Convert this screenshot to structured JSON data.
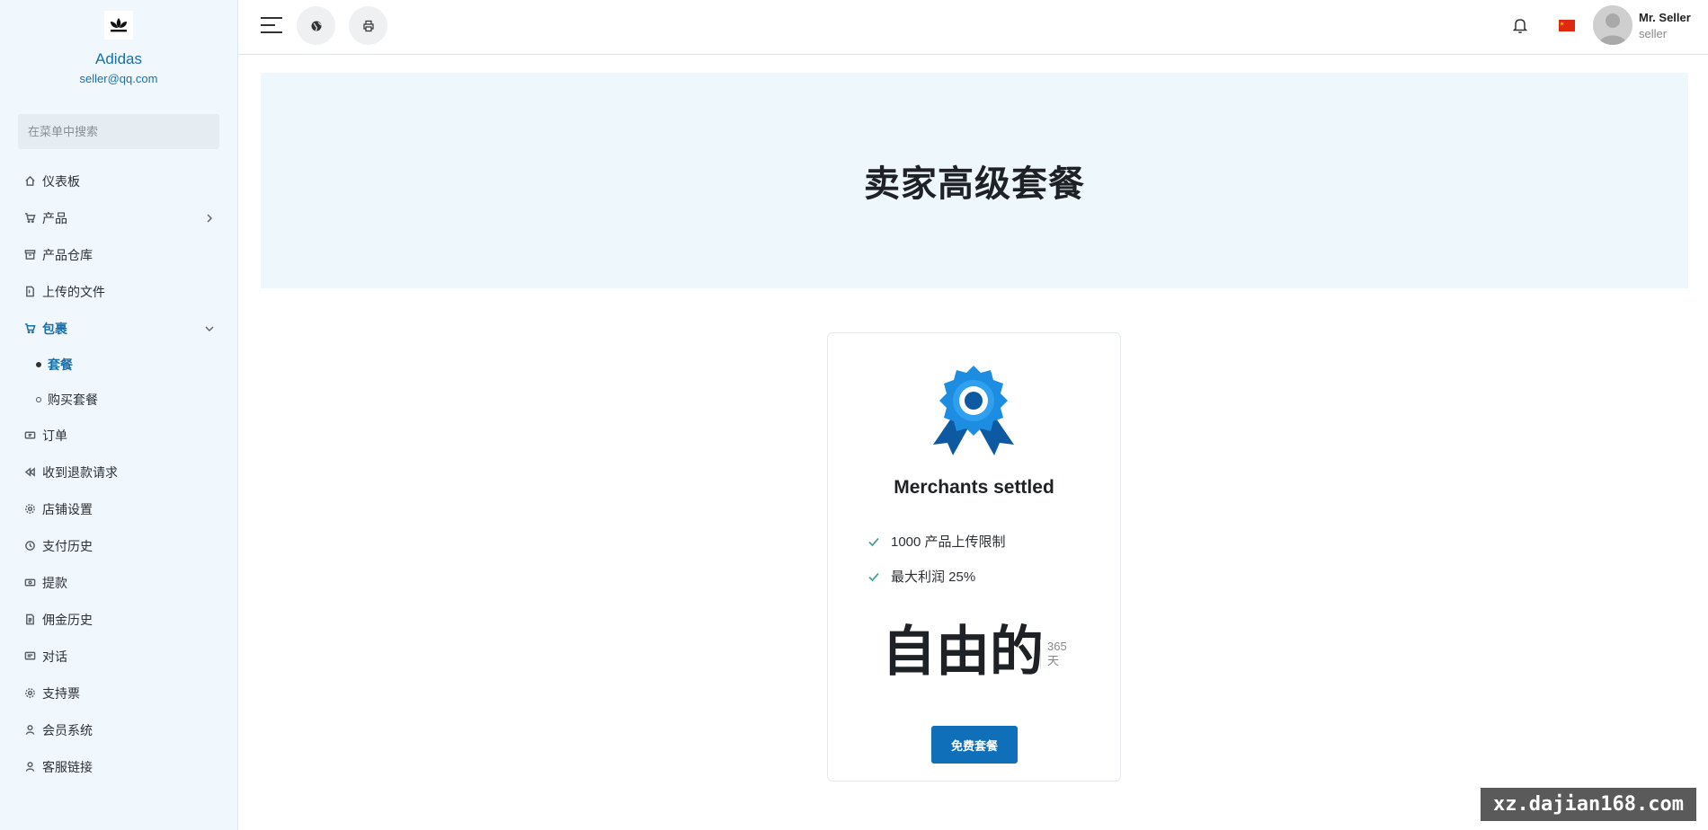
{
  "sidebar": {
    "brand_name": "Adidas",
    "brand_email": "seller@qq.com",
    "search_placeholder": "在菜单中搜索",
    "items": [
      {
        "label": "仪表板",
        "icon": "home-icon"
      },
      {
        "label": "产品",
        "icon": "cart-icon",
        "has_children": true
      },
      {
        "label": "产品仓库",
        "icon": "archive-icon"
      },
      {
        "label": "上传的文件",
        "icon": "file-icon"
      },
      {
        "label": "包裹",
        "icon": "cart-icon",
        "expanded": true,
        "active": true,
        "children": [
          {
            "label": "套餐",
            "active": true
          },
          {
            "label": "购买套餐"
          }
        ]
      },
      {
        "label": "订单",
        "icon": "ticket-icon"
      },
      {
        "label": "收到退款请求",
        "icon": "rewind-icon"
      },
      {
        "label": "店铺设置",
        "icon": "gear-icon"
      },
      {
        "label": "支付历史",
        "icon": "history-icon"
      },
      {
        "label": "提款",
        "icon": "cash-icon"
      },
      {
        "label": "佣金历史",
        "icon": "document-icon"
      },
      {
        "label": "对话",
        "icon": "chat-icon"
      },
      {
        "label": "支持票",
        "icon": "gear-icon"
      },
      {
        "label": "会员系统",
        "icon": "user-icon"
      },
      {
        "label": "客服链接",
        "icon": "user-icon"
      }
    ]
  },
  "header": {
    "user_name": "Mr. Seller",
    "user_role": "seller"
  },
  "hero": {
    "title": "卖家高级套餐"
  },
  "package": {
    "name": "Merchants settled",
    "features": [
      "1000 产品上传限制",
      "最大利润 25%"
    ],
    "price": "自由的",
    "duration": "365",
    "duration_unit": "天",
    "button_label": "免费套餐"
  },
  "watermark": "xz.dajian168.com",
  "colors": {
    "accent": "#0f6fb8",
    "sidebar_bg": "#f0f8fd",
    "hero_bg": "#eef7fc"
  }
}
